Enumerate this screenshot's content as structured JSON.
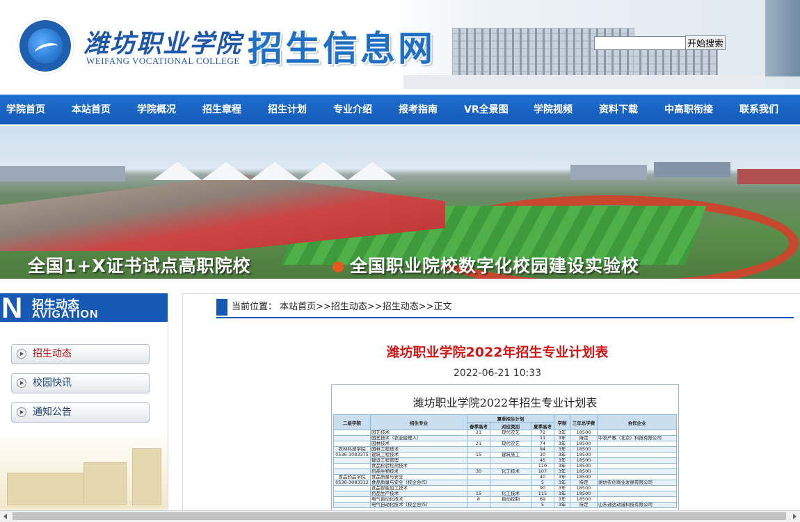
{
  "header": {
    "college_name_cn": "潍坊职业学院",
    "college_name_en": "WEIFANG VOCATIONAL COLLEGE",
    "site_title": "招生信息网",
    "search_placeholder": "",
    "search_button": "开始搜索"
  },
  "nav": [
    "学院首页",
    "本站首页",
    "学院概况",
    "招生章程",
    "招生计划",
    "专业介绍",
    "报考指南",
    "VR全景图",
    "学院视频",
    "资料下载",
    "中高职衔接",
    "联系我们"
  ],
  "banner": {
    "slogan_1": "全国1+X证书试点高职院校",
    "slogan_2": "全国职业院校数字化校园建设实验校"
  },
  "sidebar": {
    "heading_letter": "N",
    "heading_cn": "招生动态",
    "heading_en": "AVIGATION",
    "items": [
      {
        "label": "招生动态"
      },
      {
        "label": "校园快讯"
      },
      {
        "label": "通知公告"
      }
    ]
  },
  "breadcrumb": "当前位置： 本站首页>>招生动态>>招生动态>>正文",
  "article": {
    "title": "潍坊职业学院2022年招生专业计划表",
    "date": "2022-06-21 10:33"
  },
  "doc": {
    "title": "潍坊职业学院2022年招生专业计划表",
    "headers": [
      "二级学院",
      "招生专业",
      "春季高考",
      "对应类别",
      "夏季高考",
      "学制",
      "三年总学费",
      "合作企业"
    ],
    "header_group": "夏季招生计划",
    "rows": [
      [
        "",
        "园艺技术",
        "21",
        "现代农艺",
        "72",
        "3年",
        "18500",
        ""
      ],
      [
        "",
        "园艺技术（农业经理人）",
        "",
        "",
        "11",
        "3年",
        "待定",
        "中农产教（北京）科技有限公司"
      ],
      [
        "",
        "园林技术",
        "21",
        "现代农艺",
        "74",
        "3年",
        "18500",
        ""
      ],
      [
        "农林科技学院",
        "园林工程技术",
        "",
        "",
        "94",
        "3年",
        "18500",
        ""
      ],
      [
        "0536-3083375",
        "建筑工程技术",
        "15",
        "建筑施工",
        "30",
        "3年",
        "18500",
        ""
      ],
      [
        "",
        "建设工程管理",
        "",
        "",
        "45",
        "3年",
        "18500",
        ""
      ],
      [
        "",
        "食品检验检测技术",
        "",
        "",
        "110",
        "3年",
        "18500",
        ""
      ],
      [
        "",
        "药品生物技术",
        "30",
        "化工技术",
        "107",
        "3年",
        "18500",
        ""
      ],
      [
        "食品药品学院",
        "食品质量与安全",
        "",
        "",
        "40",
        "3年",
        "18500",
        ""
      ],
      [
        "0536-3083312",
        "食品质量与安全（校企合作）",
        "",
        "",
        "5",
        "3年",
        "待定",
        "潍坊农创商业发展有限公司"
      ],
      [
        "",
        "食品智能加工技术",
        "",
        "",
        "90",
        "3年",
        "18500",
        ""
      ],
      [
        "",
        "药品生产技术",
        "15",
        "化工技术",
        "115",
        "3年",
        "18500",
        ""
      ],
      [
        "",
        "电气自动化技术",
        "8",
        "自动控制",
        "69",
        "3年",
        "18500",
        ""
      ],
      [
        "",
        "电气自动化技术（校企合作）",
        "",
        "",
        "5",
        "3年",
        "待定",
        "山东通达动漫科技有限公司"
      ]
    ]
  }
}
